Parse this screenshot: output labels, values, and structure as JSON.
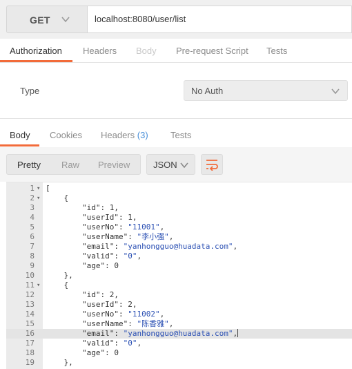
{
  "request": {
    "method": "GET",
    "url": "localhost:8080/user/list"
  },
  "request_tabs": [
    {
      "label": "Authorization",
      "state": "active"
    },
    {
      "label": "Headers",
      "state": "normal"
    },
    {
      "label": "Body",
      "state": "disabled"
    },
    {
      "label": "Pre-request Script",
      "state": "normal"
    },
    {
      "label": "Tests",
      "state": "normal"
    }
  ],
  "auth": {
    "type_label": "Type",
    "selected": "No Auth"
  },
  "response_tabs": {
    "body": "Body",
    "cookies": "Cookies",
    "headers": "Headers",
    "headers_count": "(3)",
    "tests": "Tests"
  },
  "view_modes": {
    "pretty": "Pretty",
    "raw": "Raw",
    "preview": "Preview",
    "active": "Pretty"
  },
  "format": "JSON",
  "code_lines": [
    {
      "n": "1",
      "fold": true,
      "text": "["
    },
    {
      "n": "2",
      "fold": true,
      "text": "    {"
    },
    {
      "n": "3",
      "fold": false,
      "text": "        \"id\": 1,"
    },
    {
      "n": "4",
      "fold": false,
      "text": "        \"userId\": 1,"
    },
    {
      "n": "5",
      "fold": false,
      "text": "        \"userNo\": \"11001\","
    },
    {
      "n": "6",
      "fold": false,
      "text": "        \"userName\": \"李小强\","
    },
    {
      "n": "7",
      "fold": false,
      "text": "        \"email\": \"yanhongguo@huadata.com\","
    },
    {
      "n": "8",
      "fold": false,
      "text": "        \"valid\": \"0\","
    },
    {
      "n": "9",
      "fold": false,
      "text": "        \"age\": 0"
    },
    {
      "n": "10",
      "fold": false,
      "text": "    },"
    },
    {
      "n": "11",
      "fold": true,
      "text": "    {"
    },
    {
      "n": "12",
      "fold": false,
      "text": "        \"id\": 2,"
    },
    {
      "n": "13",
      "fold": false,
      "text": "        \"userId\": 2,"
    },
    {
      "n": "14",
      "fold": false,
      "text": "        \"userNo\": \"11002\","
    },
    {
      "n": "15",
      "fold": false,
      "text": "        \"userName\": \"陈香雅\","
    },
    {
      "n": "16",
      "fold": false,
      "text": "        \"email\": \"yanhongguo@huadata.com\",",
      "highlight": true
    },
    {
      "n": "17",
      "fold": false,
      "text": "        \"valid\": \"0\","
    },
    {
      "n": "18",
      "fold": false,
      "text": "        \"age\": 0"
    },
    {
      "n": "19",
      "fold": false,
      "text": "    },"
    }
  ],
  "colors": {
    "accent": "#f26b3a",
    "string": "#2a4fb3",
    "count": "#4a90d9"
  }
}
